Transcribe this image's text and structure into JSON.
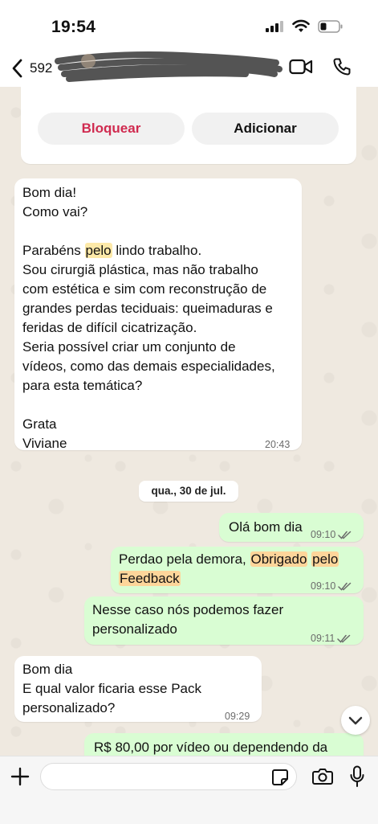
{
  "status_bar": {
    "time": "19:54"
  },
  "header": {
    "contact_number": "592"
  },
  "contact_card": {
    "block_label": "Bloquear",
    "add_label": "Adicionar"
  },
  "messages": [
    {
      "direction": "in",
      "text_1": "Bom dia!\nComo vai?\n\nParabéns ",
      "highlight": "pelo",
      "text_2": " lindo trabalho.\nSou cirurgiã plástica, mas não trabalho\ncom estética e sim com reconstrução de\ngrandes perdas teciduais: queimaduras e\nferidas de difícil cicatrização.\nSeria possível criar um conjunto de\nvídeos, como das demais especialidades,\npara esta temática?\n\nGrata\nViviane",
      "time": "20:43"
    },
    {
      "direction": "out",
      "text": "Olá bom dia",
      "time": "09:10"
    },
    {
      "direction": "out",
      "text_1": "Perdao pela demora, ",
      "highlight_1": "Obrigado",
      "text_2": " ",
      "highlight_2": "pelo",
      "text_3": "\n",
      "highlight_3": "Feedback",
      "time": "09:10"
    },
    {
      "direction": "out",
      "text": "Nesse caso nós podemos fazer\npersonalizado",
      "time": "09:11"
    },
    {
      "direction": "in",
      "text": "Bom dia\nE qual valor ficaria esse Pack\npersonalizado?",
      "time": "09:29"
    },
    {
      "direction": "out",
      "text": "R$ 80,00 por vídeo ou dependendo da"
    }
  ],
  "date_separator": "qua., 30 de jul.",
  "icons": {
    "back": "chevron-left-icon",
    "video": "video-camera-icon",
    "call": "phone-icon",
    "plus": "plus-icon",
    "sticker": "sticker-icon",
    "camera": "camera-icon",
    "mic": "microphone-icon",
    "scroll": "chevron-down-icon",
    "read": "double-check-icon"
  },
  "colors": {
    "outgoing_bubble": "#d9fdd3",
    "incoming_bubble": "#ffffff",
    "block_text": "#d02a4f",
    "highlight": "#fdd59a",
    "read_ticks": "#6b6b6b"
  }
}
